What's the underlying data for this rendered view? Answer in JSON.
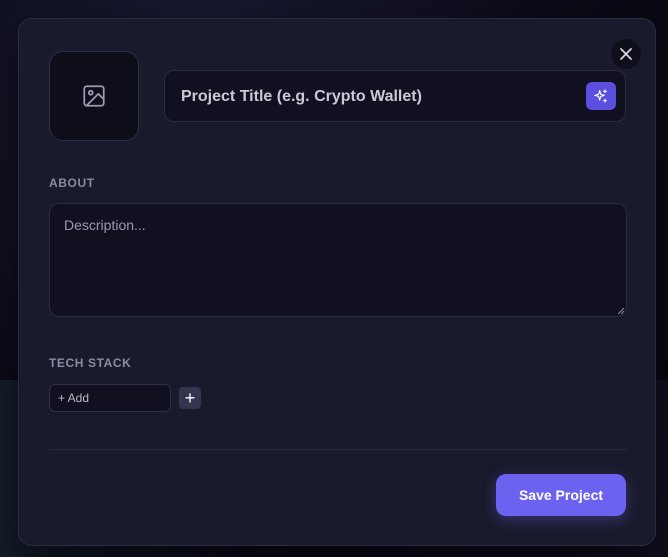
{
  "modal": {
    "title_placeholder": "Project Title (e.g. Crypto Wallet)",
    "about_label": "ABOUT",
    "description_placeholder": "Description...",
    "tech_stack_label": "TECH STACK",
    "tech_input_placeholder": "+ Add",
    "add_button_label": "+",
    "save_button_label": "Save Project"
  },
  "icons": {
    "close": "close-icon",
    "image_upload": "image-icon",
    "ai_generate": "sparkles-icon",
    "resize": "resize-grip-icon"
  },
  "colors": {
    "modal_bg": "#1a1a2d",
    "input_bg": "#101020",
    "accent": "#6b63f0",
    "ai_button": "#5b4fe0",
    "label": "#8b8ba3"
  }
}
